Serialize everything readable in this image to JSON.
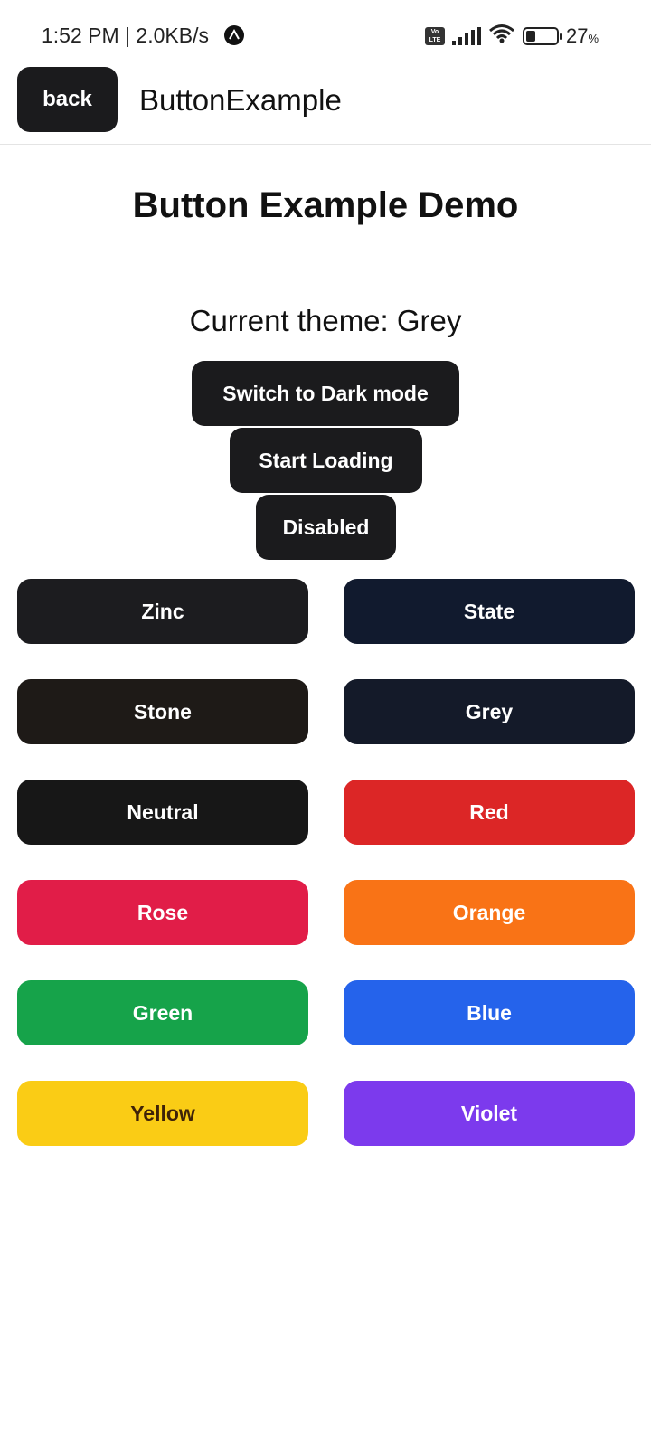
{
  "status_bar": {
    "time": "1:52 PM | 2.0KB/s",
    "volte_label": "Vo LTE",
    "battery_percent": "27",
    "battery_unit": "%",
    "battery_level": 0.27,
    "icons": [
      "app-notification-icon",
      "volte-icon",
      "signal-icon",
      "wifi-icon",
      "battery-icon"
    ]
  },
  "app_bar": {
    "back_label": "back",
    "title": "ButtonExample"
  },
  "main": {
    "heading": "Button Example Demo",
    "current_theme": "Current theme: Grey",
    "actions": {
      "switch_mode": "Switch to Dark mode",
      "start_loading": "Start Loading",
      "disabled": "Disabled"
    },
    "theme_buttons": [
      {
        "label": "Zinc",
        "bg": "#1c1c1f",
        "fg": "#ffffff"
      },
      {
        "label": "State",
        "bg": "#111a2e",
        "fg": "#ffffff"
      },
      {
        "label": "Stone",
        "bg": "#1e1a17",
        "fg": "#ffffff"
      },
      {
        "label": "Grey",
        "bg": "#141a29",
        "fg": "#ffffff"
      },
      {
        "label": "Neutral",
        "bg": "#171717",
        "fg": "#ffffff"
      },
      {
        "label": "Red",
        "bg": "#dc2626",
        "fg": "#ffffff"
      },
      {
        "label": "Rose",
        "bg": "#e11d48",
        "fg": "#ffffff"
      },
      {
        "label": "Orange",
        "bg": "#f97316",
        "fg": "#ffffff"
      },
      {
        "label": "Green",
        "bg": "#16a34a",
        "fg": "#ffffff"
      },
      {
        "label": "Blue",
        "bg": "#2563eb",
        "fg": "#ffffff"
      },
      {
        "label": "Yellow",
        "bg": "#facc15",
        "fg": "#3f2208"
      },
      {
        "label": "Violet",
        "bg": "#7c3aed",
        "fg": "#ffffff"
      }
    ]
  }
}
